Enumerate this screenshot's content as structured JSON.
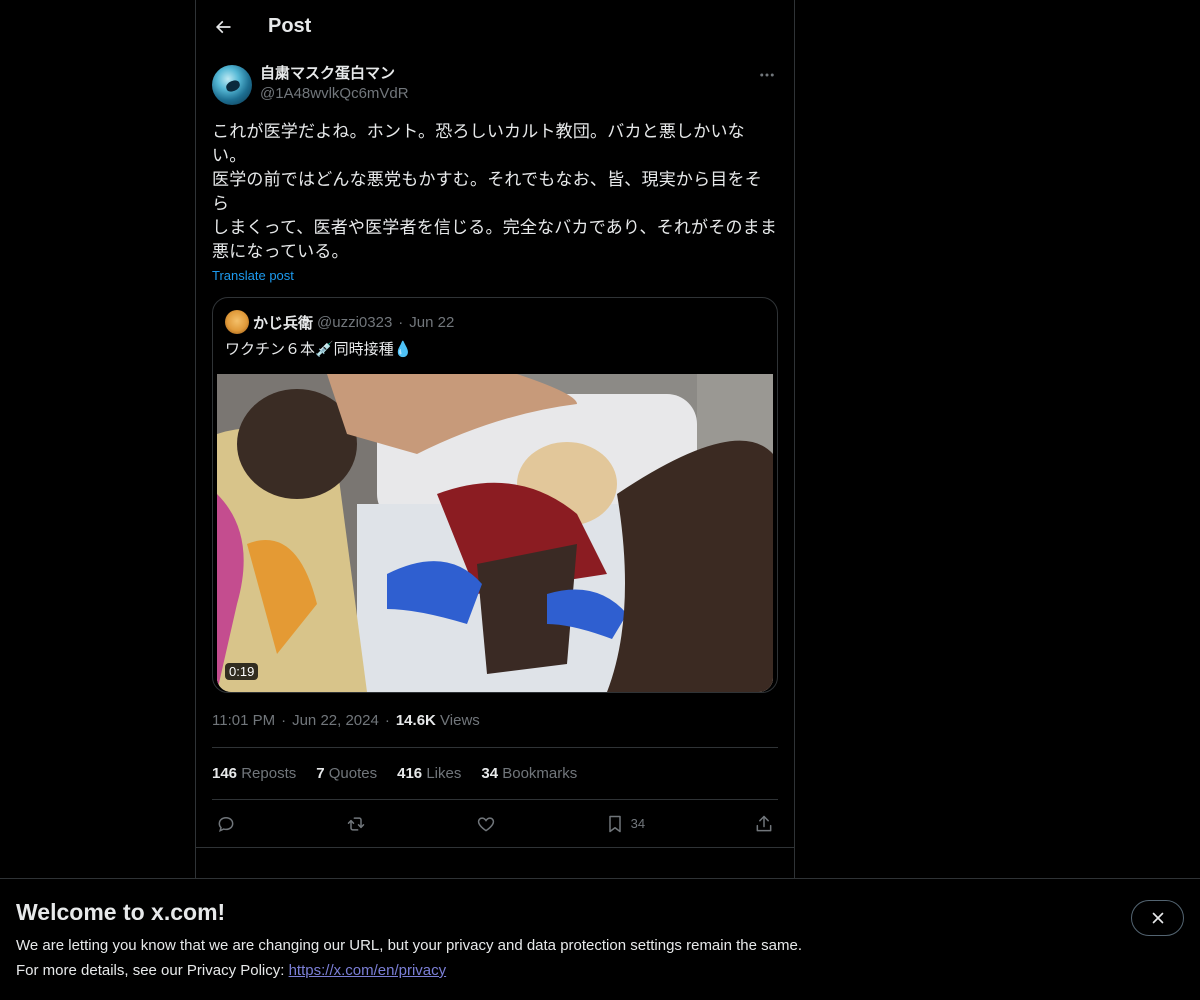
{
  "header": {
    "title": "Post"
  },
  "post": {
    "author_name": "自粛マスク蛋白マン",
    "author_handle": "@1A48wvlkQc6mVdR",
    "text": "これが医学だよね。ホント。恐ろしいカルト教団。バカと悪しかいない。\n医学の前ではどんな悪党もかすむ。それでもなお、皆、現実から目をそら\nしまくって、医者や医学者を信じる。完全なバカであり、それがそのまま\n悪になっている。",
    "translate_label": "Translate post",
    "time": "11:01 PM",
    "date": "Jun 22, 2024",
    "views_count": "14.6K",
    "views_label": "Views"
  },
  "quote": {
    "author_name": "かじ兵衛",
    "author_handle": "@uzzi0323",
    "date": "Jun 22",
    "text": "ワクチン６本💉同時接種💧",
    "video_duration": "0:19"
  },
  "stats": {
    "reposts_count": "146",
    "reposts_label": "Repost",
    "quotes_count": "7",
    "quotes_label": "Quotes",
    "likes_count": "416",
    "likes_label": "Likes",
    "bookmarks_count": "34",
    "bookmarks_label": "Bookmarks"
  },
  "actions": {
    "bookmark_count": "34"
  },
  "icons": {
    "back": "arrow-left-icon",
    "more": "more-horizontal-icon",
    "reply": "reply-icon",
    "repost": "repost-icon",
    "like": "heart-icon",
    "bookmark": "bookmark-icon",
    "share": "share-icon",
    "close": "close-icon"
  },
  "banner": {
    "title": "Welcome to x.com!",
    "line1": "We are letting you know that we are changing our URL, but your privacy and data protection settings remain the same.",
    "line2_prefix": "For more details, see our Privacy Policy: ",
    "link_text": "https://x.com/en/privacy"
  },
  "colors": {
    "background": "#000000",
    "text": "#e7e9ea",
    "muted": "#71767b",
    "link": "#1d9bf0",
    "border": "#2f3336"
  }
}
